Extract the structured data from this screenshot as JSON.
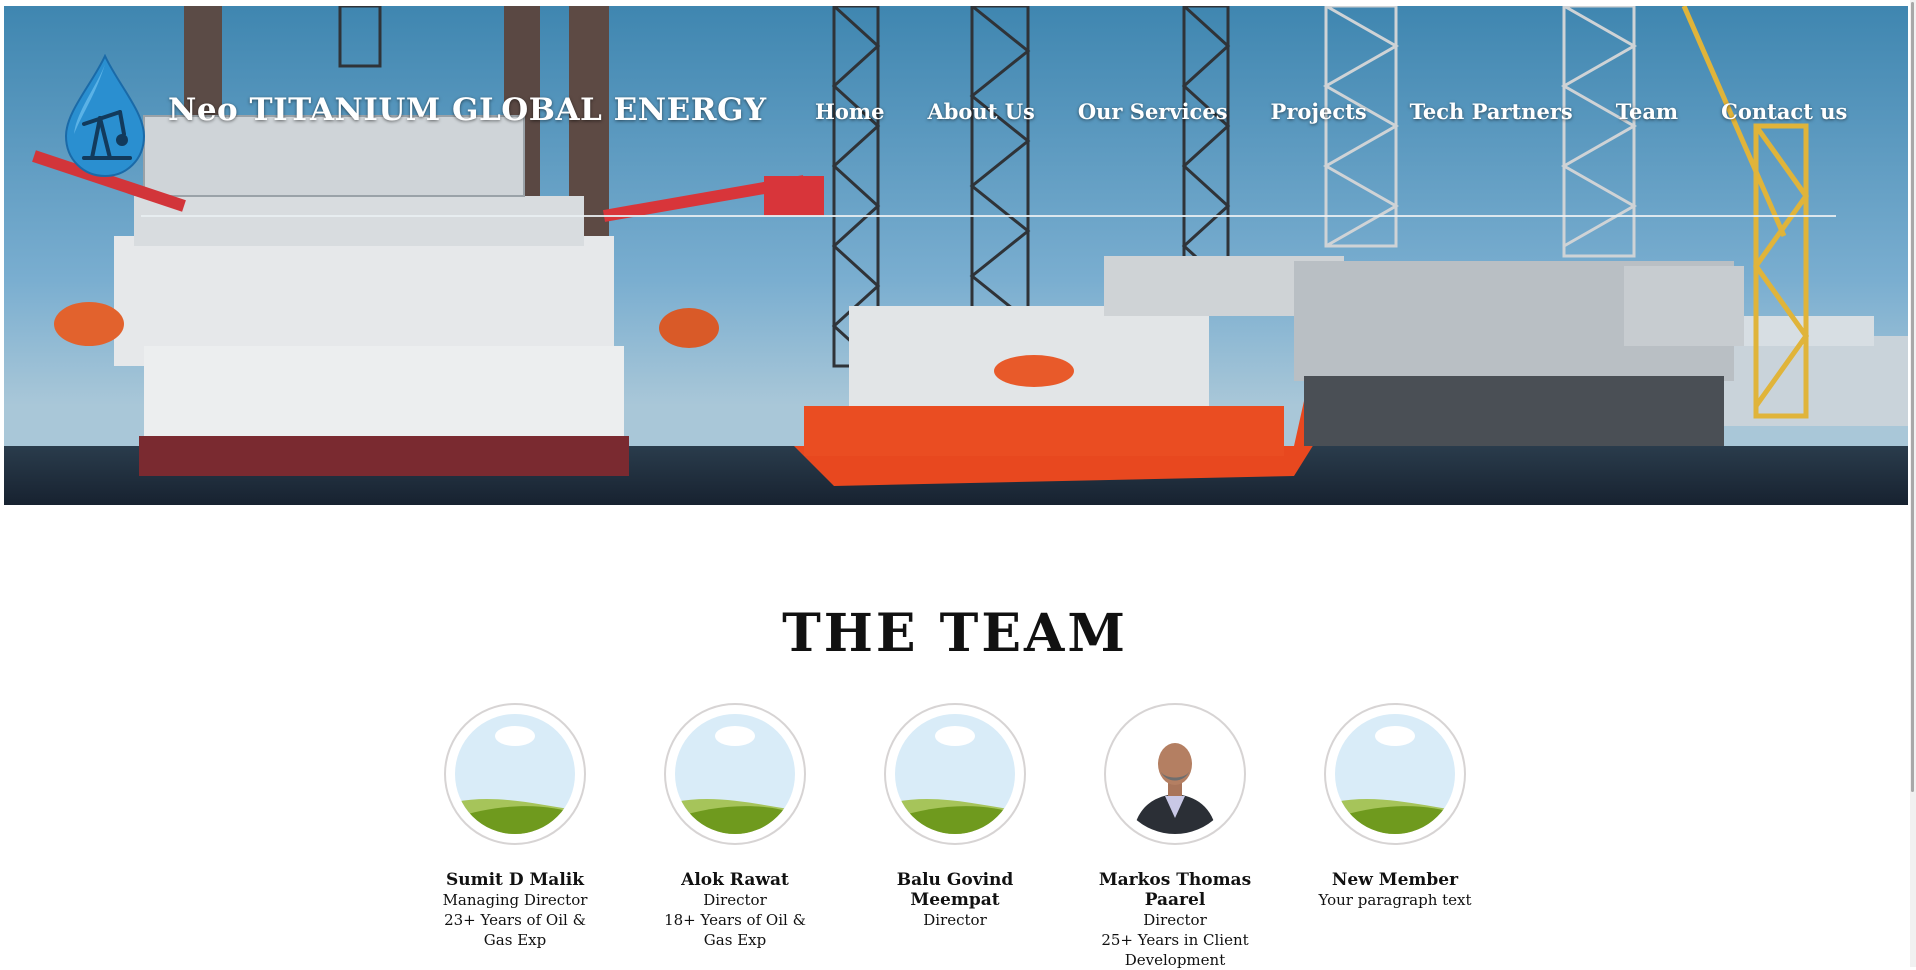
{
  "header": {
    "brand": "Neo TITANIUM GLOBAL ENERGY",
    "logo_icon": "oil-pump-drop-logo"
  },
  "nav": {
    "items": [
      "Home",
      "About Us",
      "Our Services",
      "Projects",
      "Tech Partners",
      "Team",
      "Contact us"
    ]
  },
  "team": {
    "title": "THE TEAM",
    "members": [
      {
        "name": "Sumit D Malik",
        "role": "Managing Director",
        "detail": "23+ Years of Oil & Gas Exp",
        "photo": "placeholder-landscape"
      },
      {
        "name": "Alok Rawat",
        "role": "Director",
        "detail": "18+ Years of Oil & Gas Exp",
        "photo": "placeholder-landscape"
      },
      {
        "name": "Balu Govind Meempat",
        "role": "Director",
        "detail": "",
        "photo": "placeholder-landscape"
      },
      {
        "name": "Markos Thomas Paarel",
        "role": "Director",
        "detail": "25+ Years in Client Development",
        "photo": "portrait"
      },
      {
        "name": "New Member",
        "role": "Your paragraph text",
        "detail": "",
        "photo": "placeholder-landscape"
      }
    ]
  },
  "colors": {
    "sky": "#4a8fb8",
    "vessel_orange": "#e8481f",
    "logo_blue": "#2a8fd0",
    "text": "#111111"
  }
}
